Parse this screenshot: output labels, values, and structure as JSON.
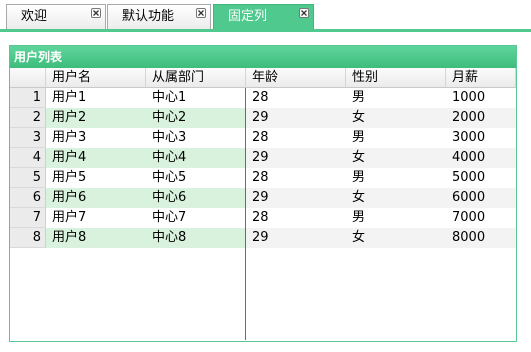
{
  "tabs": [
    {
      "label": "欢迎",
      "active": false
    },
    {
      "label": "默认功能",
      "active": false
    },
    {
      "label": "固定列",
      "active": true
    }
  ],
  "panel": {
    "title": "用户列表"
  },
  "grid": {
    "columns": [
      "用户名",
      "从属部门",
      "年龄",
      "性别",
      "月薪"
    ],
    "rows": [
      {
        "num": "1",
        "cells": [
          "用户1",
          "中心1",
          "28",
          "男",
          "1000"
        ]
      },
      {
        "num": "2",
        "cells": [
          "用户2",
          "中心2",
          "29",
          "女",
          "2000"
        ]
      },
      {
        "num": "3",
        "cells": [
          "用户3",
          "中心3",
          "28",
          "男",
          "3000"
        ]
      },
      {
        "num": "4",
        "cells": [
          "用户4",
          "中心4",
          "29",
          "女",
          "4000"
        ]
      },
      {
        "num": "5",
        "cells": [
          "用户5",
          "中心5",
          "28",
          "男",
          "5000"
        ]
      },
      {
        "num": "6",
        "cells": [
          "用户6",
          "中心6",
          "29",
          "女",
          "6000"
        ]
      },
      {
        "num": "7",
        "cells": [
          "用户7",
          "中心7",
          "28",
          "男",
          "7000"
        ]
      },
      {
        "num": "8",
        "cells": [
          "用户8",
          "中心8",
          "29",
          "女",
          "8000"
        ]
      }
    ]
  },
  "colors": {
    "accent": "#4fc98d",
    "frozen_row_alt": "#d9f2dd",
    "scroll_row_alt": "#f3f3f3",
    "frozen_divider": "#2f7f9d"
  },
  "scrollbar": {
    "left_icon": "arrow-left-icon",
    "right_icon": "arrow-right-icon",
    "grip_icon": "grip-icon"
  }
}
